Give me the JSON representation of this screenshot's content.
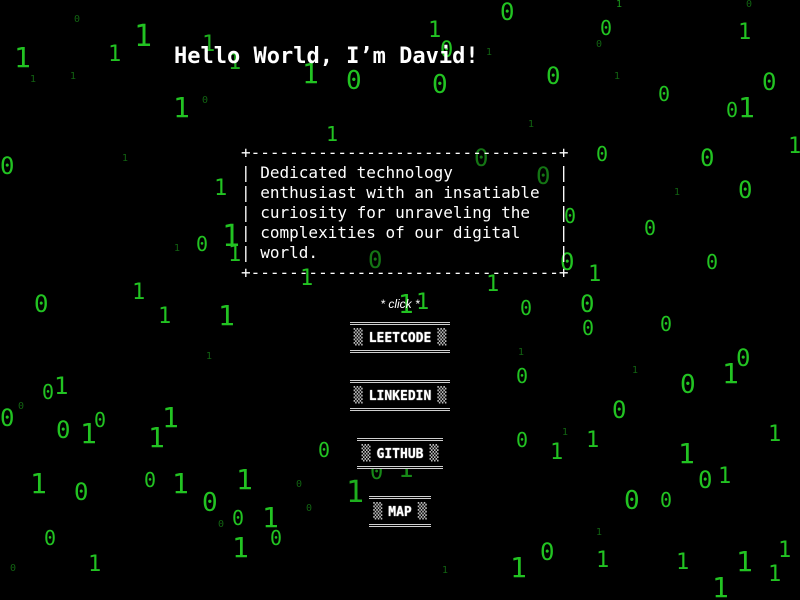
{
  "title": "Hello World, I’m David!",
  "bio": {
    "lines": [
      "+--------------------------------+",
      "| Dedicated technology           |",
      "| enthusiast with an insatiable  |",
      "| curiosity for unraveling the   |",
      "| complexities of our digital    |",
      "| world.                         |",
      "+--------------------------------+"
    ]
  },
  "click_hint": "* click *",
  "buttons": {
    "shade_glyph": "▒",
    "leetcode": "LEETCODE",
    "linkedin": "LINKEDIN",
    "github": "GITHUB",
    "map": "MAP"
  },
  "rain": {
    "glyphs": [
      "0",
      "1"
    ],
    "color": "#22c322"
  }
}
